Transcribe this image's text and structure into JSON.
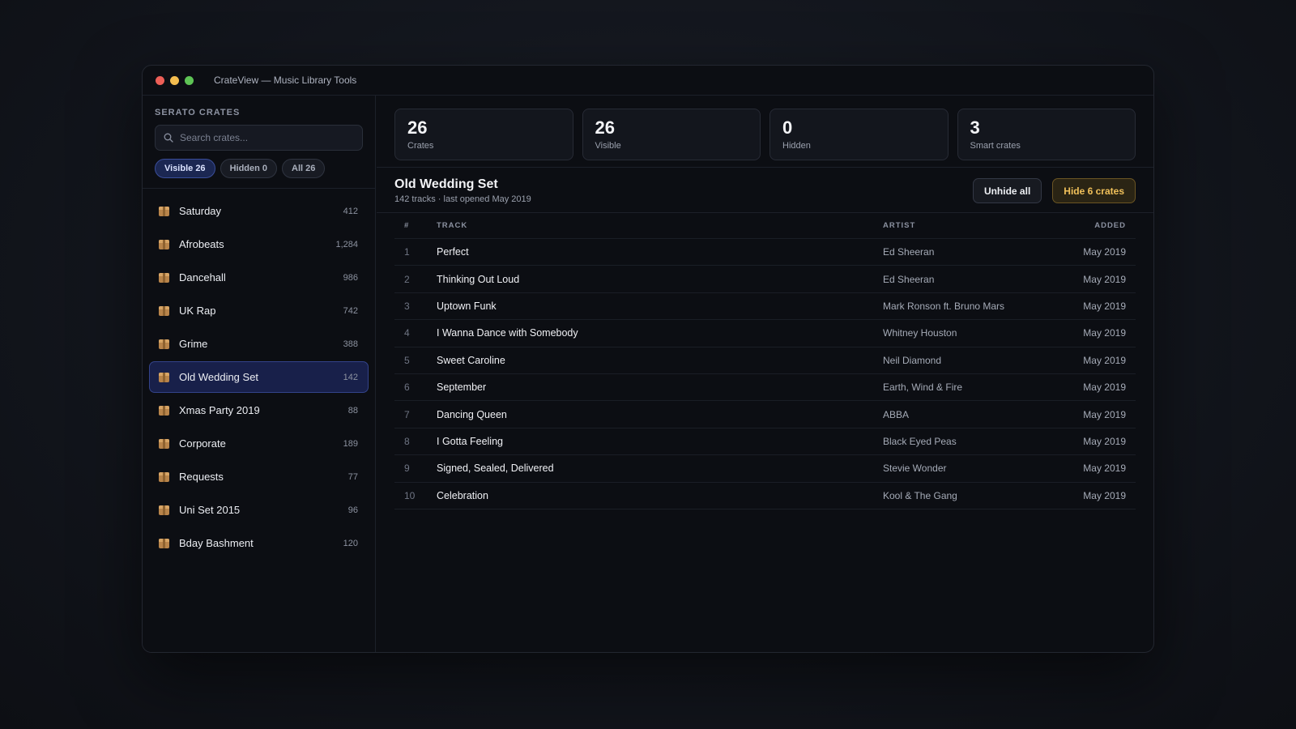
{
  "window": {
    "title": "CrateView — Music Library Tools"
  },
  "sidebar": {
    "heading": "SERATO CRATES",
    "search_placeholder": "Search crates...",
    "filters": [
      {
        "label": "Visible 26",
        "active": true
      },
      {
        "label": "Hidden 0",
        "active": false
      },
      {
        "label": "All 26",
        "active": false
      }
    ],
    "crates": [
      {
        "name": "Saturday",
        "count": "412"
      },
      {
        "name": "Afrobeats",
        "count": "1,284"
      },
      {
        "name": "Dancehall",
        "count": "986"
      },
      {
        "name": "UK Rap",
        "count": "742"
      },
      {
        "name": "Grime",
        "count": "388"
      },
      {
        "name": "Old Wedding Set",
        "count": "142",
        "selected": true
      },
      {
        "name": "Xmas Party 2019",
        "count": "88"
      },
      {
        "name": "Corporate",
        "count": "189"
      },
      {
        "name": "Requests",
        "count": "77"
      },
      {
        "name": "Uni Set 2015",
        "count": "96"
      },
      {
        "name": "Bday Bashment",
        "count": "120"
      }
    ]
  },
  "stats": [
    {
      "value": "26",
      "label": "Crates"
    },
    {
      "value": "26",
      "label": "Visible"
    },
    {
      "value": "0",
      "label": "Hidden"
    },
    {
      "value": "3",
      "label": "Smart crates"
    }
  ],
  "crate": {
    "title": "Old Wedding Set",
    "subtitle": "142 tracks · last opened May 2019",
    "unhide_label": "Unhide all",
    "hide_label": "Hide 6 crates"
  },
  "table": {
    "headers": {
      "num": "#",
      "track": "TRACK",
      "artist": "ARTIST",
      "added": "ADDED"
    },
    "rows": [
      {
        "num": "1",
        "track": "Perfect",
        "artist": "Ed Sheeran",
        "added": "May 2019"
      },
      {
        "num": "2",
        "track": "Thinking Out Loud",
        "artist": "Ed Sheeran",
        "added": "May 2019"
      },
      {
        "num": "3",
        "track": "Uptown Funk",
        "artist": "Mark Ronson ft. Bruno Mars",
        "added": "May 2019"
      },
      {
        "num": "4",
        "track": "I Wanna Dance with Somebody",
        "artist": "Whitney Houston",
        "added": "May 2019"
      },
      {
        "num": "5",
        "track": "Sweet Caroline",
        "artist": "Neil Diamond",
        "added": "May 2019"
      },
      {
        "num": "6",
        "track": "September",
        "artist": "Earth, Wind & Fire",
        "added": "May 2019"
      },
      {
        "num": "7",
        "track": "Dancing Queen",
        "artist": "ABBA",
        "added": "May 2019"
      },
      {
        "num": "8",
        "track": "I Gotta Feeling",
        "artist": "Black Eyed Peas",
        "added": "May 2019"
      },
      {
        "num": "9",
        "track": "Signed, Sealed, Delivered",
        "artist": "Stevie Wonder",
        "added": "May 2019"
      },
      {
        "num": "10",
        "track": "Celebration",
        "artist": "Kool & The Gang",
        "added": "May 2019"
      }
    ]
  },
  "colors": {
    "accent": "#3a4e9a",
    "warning": "#f0c05a",
    "traffic_red": "#ed5f57",
    "traffic_yellow": "#f4bd4f",
    "traffic_green": "#5ec455"
  },
  "icons": {
    "search": "search-icon",
    "crate": "crate-icon"
  }
}
